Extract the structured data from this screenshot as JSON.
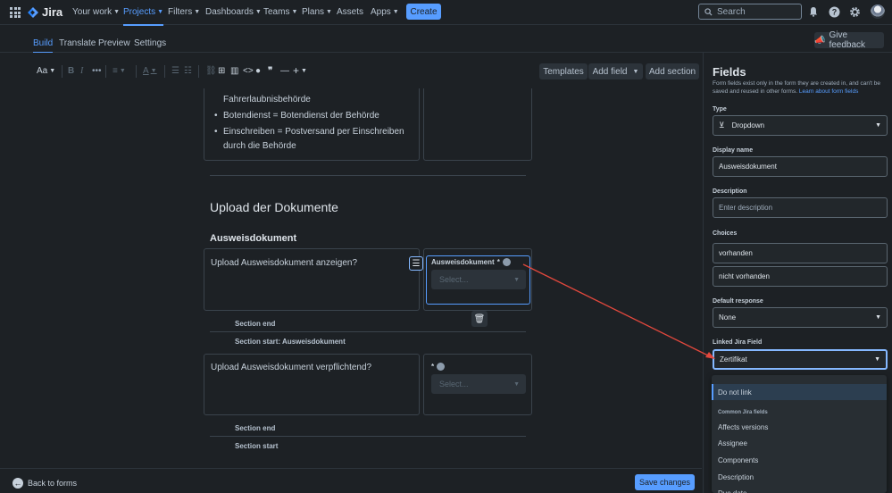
{
  "topnav": {
    "logo": "Jira",
    "items": [
      "Your work",
      "Projects",
      "Filters",
      "Dashboards",
      "Teams",
      "Plans",
      "Assets",
      "Apps"
    ],
    "create": "Create",
    "search_placeholder": "Search"
  },
  "subnav": {
    "tabs": [
      "Build",
      "Translate",
      "Preview",
      "Settings"
    ],
    "feedback": "Give feedback"
  },
  "toolbar": {
    "text_style": "Aa",
    "templates": "Templates",
    "add_field": "Add field",
    "add_section": "Add section"
  },
  "form": {
    "top_card": {
      "line1": "Fahrerlaubnisbehörde",
      "bullet1": "Botendienst = Botendienst der Behörde",
      "bullet2_a": "Einschreiben = Postversand per Einschreiben",
      "bullet2_b": "durch die Behörde"
    },
    "heading": "Upload der Dokumente",
    "subheading": "Ausweisdokument",
    "q1": {
      "question": "Upload Ausweisdokument anzeigen?",
      "field_label": "Ausweisdokument",
      "required_mark": "*",
      "placeholder": "Select..."
    },
    "section_end_1": "Section end",
    "section_start_1_prefix": "Section start: ",
    "section_start_1_name": "Ausweisdokument",
    "q2": {
      "question": "Upload Ausweisdokument verpflichtend?",
      "required_mark": "*",
      "placeholder": "Select..."
    },
    "section_end_2": "Section end",
    "section_start_2": "Section start"
  },
  "bottombar": {
    "back": "Back to forms",
    "save": "Save changes"
  },
  "panel": {
    "title": "Fields",
    "desc": "Form fields exist only in the form they are created in, and can't be saved and reused in other forms.",
    "desc_link": "Learn about form fields",
    "type_label": "Type",
    "type_value": "Dropdown",
    "display_name_label": "Display name",
    "display_name_value": "Ausweisdokument",
    "description_label": "Description",
    "description_placeholder": "Enter description",
    "choices_label": "Choices",
    "choices": [
      "vorhanden",
      "nicht vorhanden"
    ],
    "default_response_label": "Default response",
    "default_response_value": "None",
    "linked_field_label": "Linked Jira Field",
    "linked_field_value": "Zertifikat"
  },
  "dropdown": {
    "do_not_link": "Do not link",
    "group": "Common Jira fields",
    "options": [
      "Affects versions",
      "Assignee",
      "Components",
      "Description",
      "Due date"
    ]
  },
  "colors": {
    "accent": "#579dff",
    "background": "#1d2125",
    "arrow": "#e2483d"
  }
}
